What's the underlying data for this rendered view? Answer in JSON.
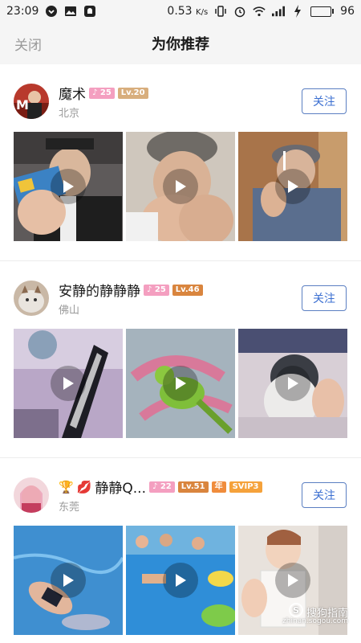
{
  "status_bar": {
    "time": "23:09",
    "speed": "0.53",
    "speed_unit": "K/s",
    "battery": "96",
    "battery_level": 0.96
  },
  "header": {
    "close_label": "关闭",
    "title": "为你推荐"
  },
  "users": [
    {
      "name": "魔术",
      "fans_badge": "25",
      "level_badge": "Lv.20",
      "location": "北京",
      "follow_label": "关注"
    },
    {
      "name": "安静的静静静",
      "fans_badge": "25",
      "level_badge": "Lv.46",
      "location": "佛山",
      "follow_label": "关注"
    },
    {
      "name": "静静Q...",
      "fans_badge": "22",
      "level_badge": "Lv.51",
      "year_badge": "年",
      "svip_badge": "SVIP3",
      "location": "东莞",
      "follow_label": "关注"
    }
  ],
  "watermark": {
    "text": "搜狗指南",
    "sub": "zhinan.sogou.com"
  },
  "colors": {
    "accent": "#3b6fd1",
    "fans_badge": "#f49fc0",
    "level_badge": "#d8ae7d"
  }
}
